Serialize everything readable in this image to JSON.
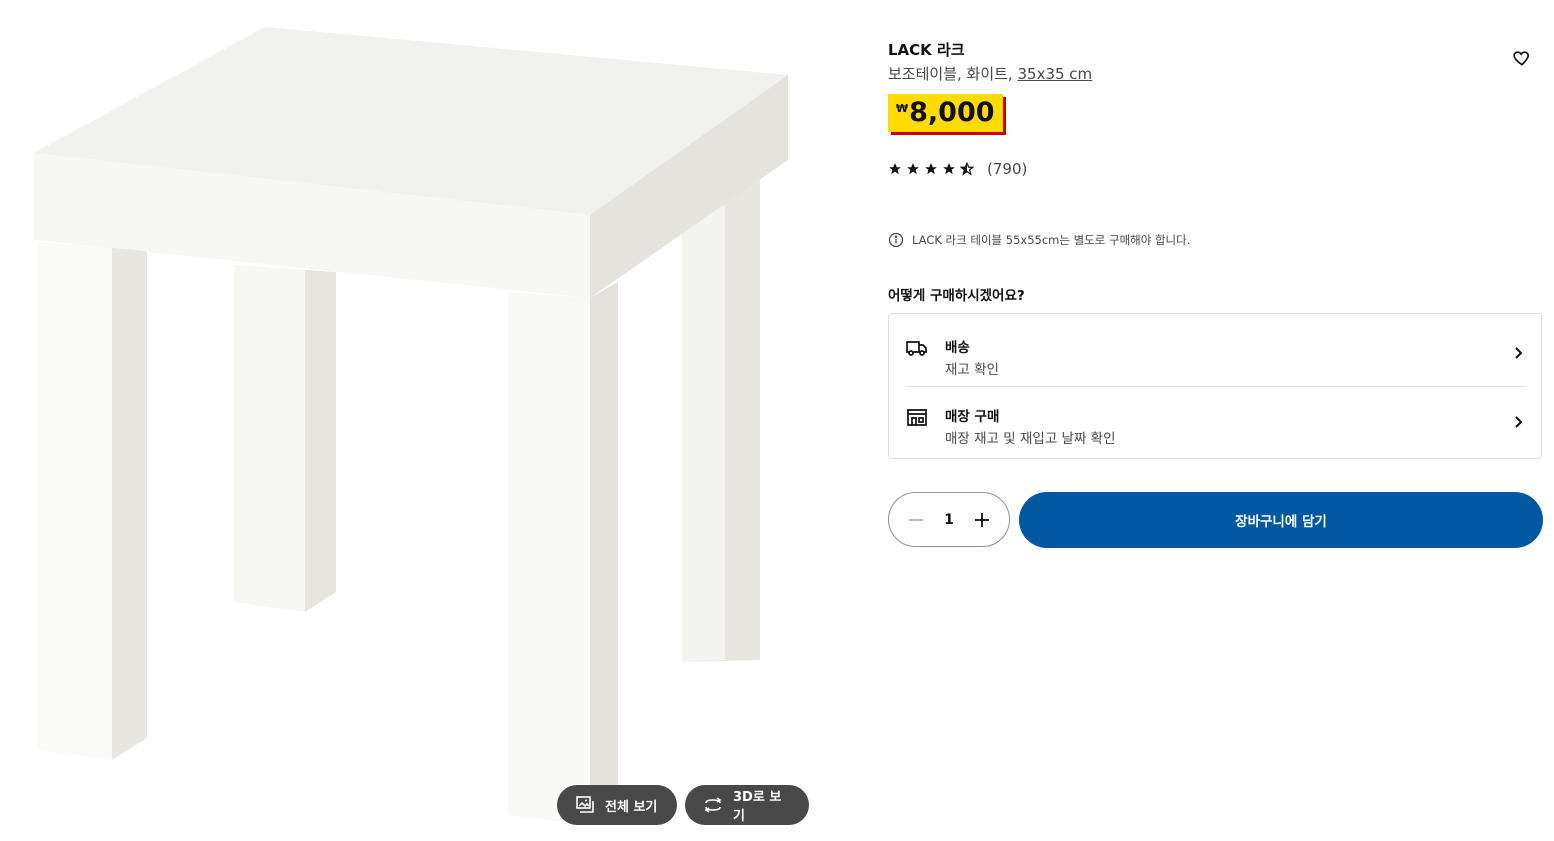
{
  "gallery": {
    "view_all_label": "전체 보기",
    "view_3d_label": "3D로 보기"
  },
  "product": {
    "name": "LACK 라크",
    "description_prefix": "보조테이블, 화이트, ",
    "dimensions": "35x35 cm",
    "currency_symbol": "₩",
    "price": "8,000",
    "rating_stars": 4.5,
    "rating_max": 5,
    "review_count": "(790)",
    "note": "LACK 라크 테이블 55x55cm는 별도로 구매해야 합니다."
  },
  "purchase": {
    "section_title": "어떻게 구매하시겠어요?",
    "options": [
      {
        "label": "배송",
        "sub": "재고 확인",
        "icon": "truck-icon"
      },
      {
        "label": "매장 구매",
        "sub": "매장 재고 및 재입고 날짜 확인",
        "icon": "store-icon"
      }
    ]
  },
  "cart": {
    "quantity": "1",
    "add_label": "장바구니에 담기"
  },
  "colors": {
    "price_bg": "#ffdb00",
    "price_shadow": "#cc0008",
    "primary": "#0058a3",
    "pill_bg": "#484848"
  }
}
